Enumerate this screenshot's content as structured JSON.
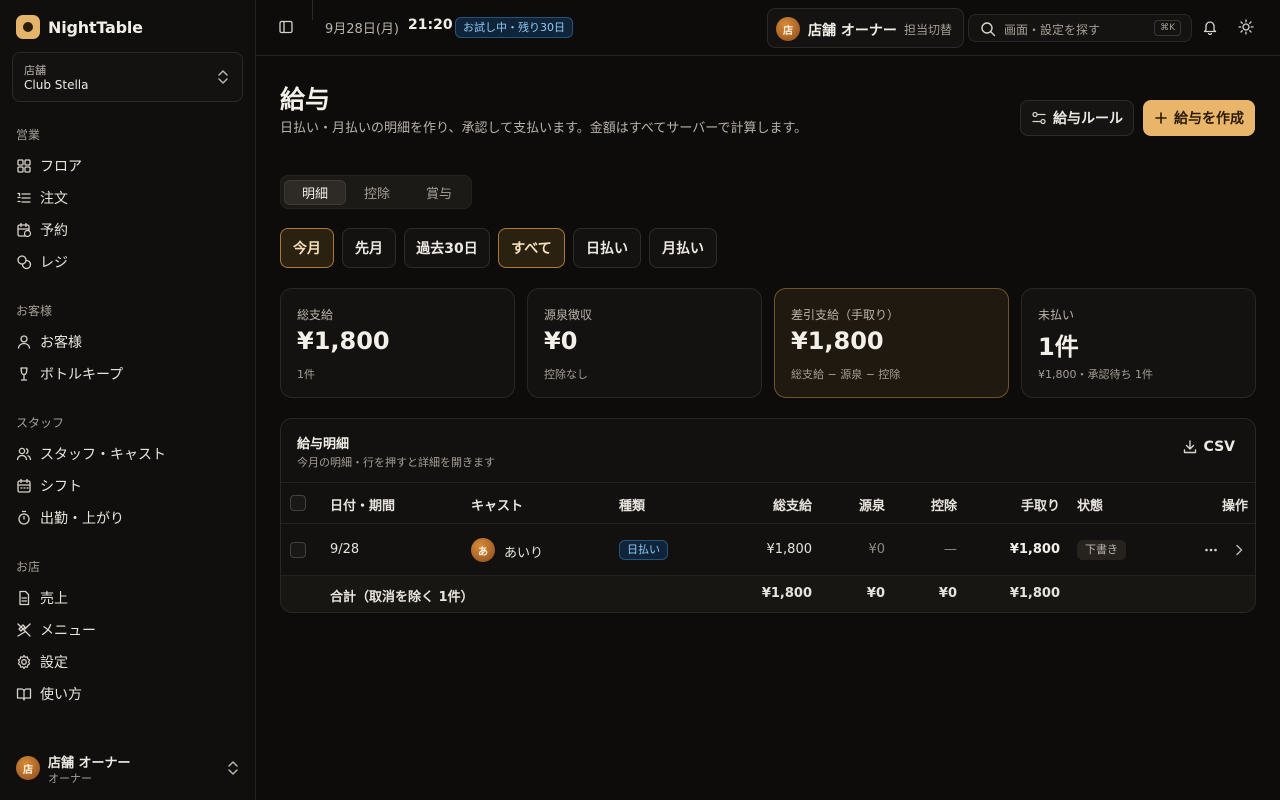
{
  "app": {
    "name": "NightTable"
  },
  "store": {
    "label": "店舗",
    "value": "Club Stella"
  },
  "nav": {
    "groups": [
      {
        "title": "営業",
        "items": [
          "フロア",
          "注文",
          "予約",
          "レジ"
        ]
      },
      {
        "title": "お客様",
        "items": [
          "お客様",
          "ボトルキープ"
        ]
      },
      {
        "title": "スタッフ",
        "items": [
          "スタッフ・キャスト",
          "シフト",
          "出勤・上がり"
        ]
      },
      {
        "title": "お店",
        "items": [
          "売上",
          "メニュー",
          "設定",
          "使い方"
        ]
      }
    ]
  },
  "user": {
    "avatar": "店",
    "name": "店舗 オーナー",
    "role": "オーナー"
  },
  "topbar": {
    "date": "9月28日(月)",
    "time": "21:20",
    "trial": "お試し中・残り30日",
    "owner_avatar": "店",
    "owner_name": "店舗 オーナー",
    "owner_switch": "担当切替",
    "search_placeholder": "画面・設定を探す",
    "search_kbd": "⌘K"
  },
  "page": {
    "title": "給与",
    "description": "日払い・月払いの明細を作り、承認して支払います。金額はすべてサーバーで計算します。",
    "rules_button": "給与ルール",
    "create_button": "給与を作成"
  },
  "tabs": [
    "明細",
    "控除",
    "賞与"
  ],
  "active_tab": 0,
  "period_filters": [
    "今月",
    "先月",
    "過去30日"
  ],
  "active_period": 0,
  "type_filters": [
    "すべて",
    "日払い",
    "月払い"
  ],
  "active_type": 0,
  "summary": [
    {
      "label": "総支給",
      "value": "¥1,800",
      "sub": "1件"
    },
    {
      "label": "源泉徴収",
      "value": "¥0",
      "sub": "控除なし"
    },
    {
      "label": "差引支給（手取り）",
      "value": "¥1,800",
      "sub": "総支給 − 源泉 − 控除"
    },
    {
      "label": "未払い",
      "value": "1件",
      "sub": "¥1,800・承認待ち 1件"
    }
  ],
  "table": {
    "title": "給与明細",
    "subtitle": "今月の明細・行を押すと詳細を開きます",
    "csv": "CSV",
    "columns": [
      "日付・期間",
      "キャスト",
      "種類",
      "総支給",
      "源泉",
      "控除",
      "手取り",
      "状態",
      "操作"
    ],
    "rows": [
      {
        "date": "9/28",
        "cast_avatar": "あ",
        "cast": "あいり",
        "type": "日払い",
        "gross": "¥1,800",
        "withholding": "¥0",
        "deduction": "—",
        "net": "¥1,800",
        "status": "下書き"
      }
    ],
    "footer": {
      "label": "合計（取消を除く 1件）",
      "gross": "¥1,800",
      "withholding": "¥0",
      "deduction": "¥0",
      "net": "¥1,800"
    }
  },
  "colors": {
    "accent": "#e8b56a",
    "background": "#0d0c0b",
    "info": "#8ec7f4"
  }
}
